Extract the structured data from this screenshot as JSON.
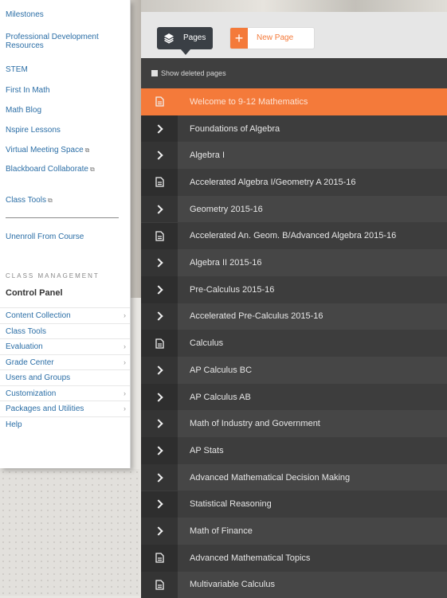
{
  "sidebar": {
    "tools": [
      {
        "label": "Milestones",
        "ext": false
      },
      {
        "label": "Professional Development Resources",
        "ext": false
      },
      {
        "label": "STEM",
        "ext": false
      },
      {
        "label": "First In Math",
        "ext": false
      },
      {
        "label": "Math Blog",
        "ext": false
      },
      {
        "label": "Nspire Lessons",
        "ext": false
      },
      {
        "label": "Virtual Meeting Space",
        "ext": true
      },
      {
        "label": "Blackboard Collaborate",
        "ext": true
      },
      {
        "label": "Class Tools",
        "ext": true
      }
    ],
    "unenroll_label": "Unenroll From Course",
    "section_label": "CLASS MANAGEMENT",
    "control_panel_title": "Control Panel",
    "control_panel_items": [
      {
        "label": "Content Collection",
        "chevron": true
      },
      {
        "label": "Class Tools",
        "chevron": false
      },
      {
        "label": "Evaluation",
        "chevron": true
      },
      {
        "label": "Grade Center",
        "chevron": true
      },
      {
        "label": "Users and Groups",
        "chevron": false
      },
      {
        "label": "Customization",
        "chevron": true
      },
      {
        "label": "Packages and Utilities",
        "chevron": true
      },
      {
        "label": "Help",
        "chevron": false
      }
    ],
    "ext_icon": "external-link-icon",
    "chevron_glyph": "›"
  },
  "toolbar": {
    "pages_label": "Pages",
    "pages_icon": "layers-icon",
    "new_page_label": "New Page",
    "new_page_icon": "plus-icon"
  },
  "pages": {
    "show_deleted_label": "Show deleted pages",
    "items": [
      {
        "title": "Welcome to 9-12 Mathematics",
        "icon": "document-icon",
        "active": true
      },
      {
        "title": "Foundations of Algebra",
        "icon": "chevron-right-icon",
        "active": false
      },
      {
        "title": "Algebra I",
        "icon": "chevron-right-icon",
        "active": false
      },
      {
        "title": "Accelerated Algebra I/Geometry A 2015-16",
        "icon": "document-icon",
        "active": false
      },
      {
        "title": "Geometry 2015-16",
        "icon": "chevron-right-icon",
        "active": false
      },
      {
        "title": "Accelerated An. Geom. B/Advanced Algebra 2015-16",
        "icon": "document-icon",
        "active": false
      },
      {
        "title": "Algebra II 2015-16",
        "icon": "chevron-right-icon",
        "active": false
      },
      {
        "title": "Pre-Calculus 2015-16",
        "icon": "chevron-right-icon",
        "active": false
      },
      {
        "title": "Accelerated Pre-Calculus 2015-16",
        "icon": "chevron-right-icon",
        "active": false
      },
      {
        "title": "Calculus",
        "icon": "document-icon",
        "active": false
      },
      {
        "title": "AP Calculus BC",
        "icon": "chevron-right-icon",
        "active": false
      },
      {
        "title": "AP Calculus AB",
        "icon": "chevron-right-icon",
        "active": false
      },
      {
        "title": "Math of Industry and Government",
        "icon": "chevron-right-icon",
        "active": false
      },
      {
        "title": "AP Stats",
        "icon": "chevron-right-icon",
        "active": false
      },
      {
        "title": "Advanced Mathematical Decision Making",
        "icon": "chevron-right-icon",
        "active": false
      },
      {
        "title": "Statistical Reasoning",
        "icon": "chevron-right-icon",
        "active": false
      },
      {
        "title": "Math of Finance",
        "icon": "chevron-right-icon",
        "active": false
      },
      {
        "title": "Advanced Mathematical Topics",
        "icon": "document-icon",
        "active": false
      },
      {
        "title": "Multivariable Calculus",
        "icon": "document-icon",
        "active": false
      }
    ]
  },
  "colors": {
    "accent": "#f47a3a",
    "link": "#2b6ea6",
    "panel_dark": "#3d3d3d",
    "panel_light": "#464646"
  }
}
